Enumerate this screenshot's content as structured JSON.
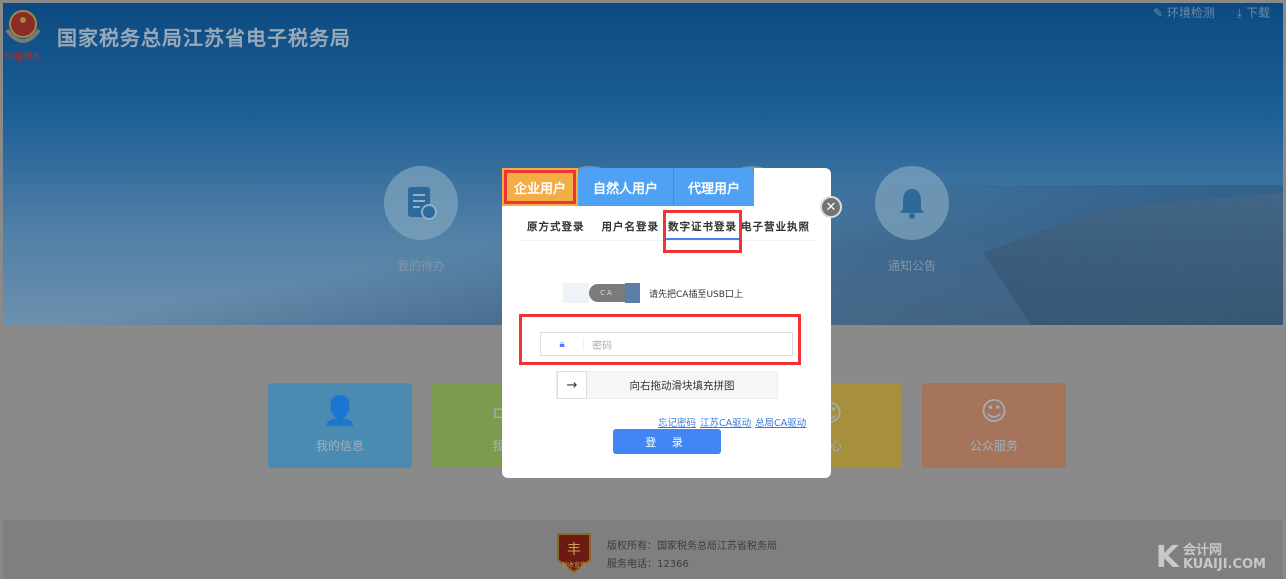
{
  "header": {
    "title": "国家税务总局江苏省电子税务局",
    "logo_text": "中国税务",
    "links": [
      {
        "icon": "wrench-icon",
        "label": "环境检测"
      },
      {
        "icon": "download-icon",
        "label": "下载"
      }
    ]
  },
  "quick_circles": [
    {
      "label": "我的待办",
      "icon": "document-clock-icon"
    },
    {
      "label": "通知公告",
      "icon": "bell-icon"
    }
  ],
  "tiles": [
    {
      "label": "我的信息",
      "color": "#4b8bb1",
      "icon": "user-icon"
    },
    {
      "label": "我要",
      "color": "#7c9b4f",
      "icon": "monitor-icon"
    },
    {
      "label": "中心",
      "color": "#a88f3d",
      "icon": "chat-icon"
    },
    {
      "label": "公众服务",
      "color": "#a5745b",
      "icon": "service-icon"
    }
  ],
  "modal": {
    "user_tabs": [
      "企业用户",
      "自然人用户",
      "代理用户"
    ],
    "login_tabs": [
      "原方式登录",
      "用户名登录",
      "数字证书登录",
      "电子营业执照"
    ],
    "active_login_tab": "数字证书登录",
    "ca_label": "CA",
    "ca_hint": "请先把CA插至USB口上",
    "password_placeholder": "密码",
    "slider_text": "向右拖动滑块填充拼图",
    "links": [
      "忘记密码",
      "江苏CA驱动",
      "总局CA驱动"
    ],
    "login_button": "登 录"
  },
  "footer": {
    "copyright": "版权所有：国家税务总局江苏省税务局",
    "phone": "服务电话：12366",
    "badge_text": "税收宣传"
  },
  "watermark": {
    "cn": "会计网",
    "en": "KUAIJI.COM"
  },
  "colors": {
    "highlight": "#f03333",
    "active_user_tab": "#f3ad47",
    "user_tab": "#4ea1f3",
    "login_button": "#4286f5"
  }
}
